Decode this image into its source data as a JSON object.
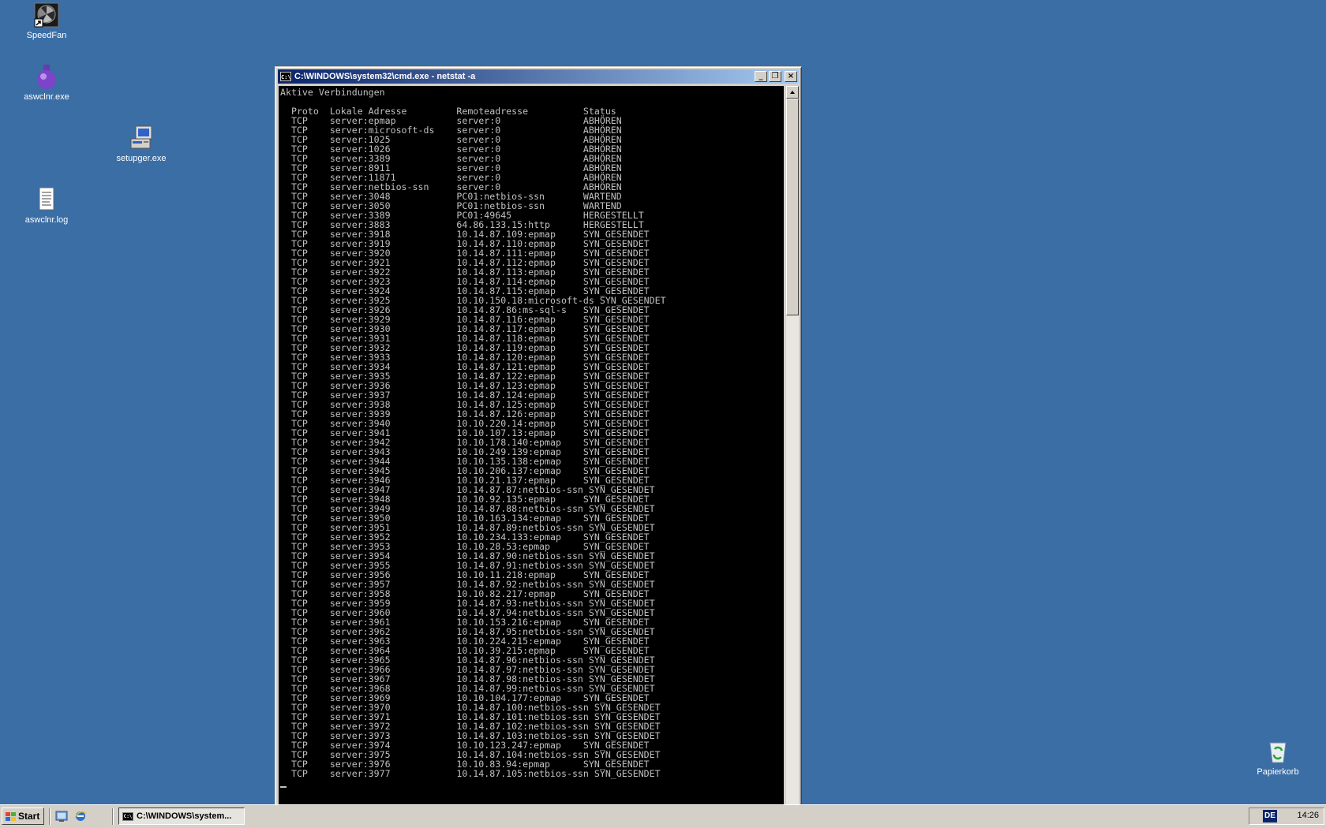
{
  "desktop": {
    "icons": [
      {
        "label": "SpeedFan",
        "icon": "speedfan-icon"
      },
      {
        "label": "aswclnr.exe",
        "icon": "purple-flask-icon"
      },
      {
        "label": "setupger.exe",
        "icon": "installer-computer-icon"
      },
      {
        "label": "aswclnr.log",
        "icon": "text-document-icon"
      },
      {
        "label": "Papierkorb",
        "icon": "recycle-bin-icon"
      }
    ]
  },
  "window": {
    "title": "C:\\WINDOWS\\system32\\cmd.exe - netstat -a",
    "icon_text": "C:\\",
    "buttons": {
      "minimize": "_",
      "restore": "❐",
      "close": "×"
    }
  },
  "console": {
    "heading": "Aktive Verbindungen",
    "columns": [
      "Proto",
      "Lokale Adresse",
      "Remoteadresse",
      "Status"
    ],
    "rows": [
      [
        "TCP",
        "server:epmap",
        "server:0",
        "ABHÖREN"
      ],
      [
        "TCP",
        "server:microsoft-ds",
        "server:0",
        "ABHÖREN"
      ],
      [
        "TCP",
        "server:1025",
        "server:0",
        "ABHÖREN"
      ],
      [
        "TCP",
        "server:1026",
        "server:0",
        "ABHÖREN"
      ],
      [
        "TCP",
        "server:3389",
        "server:0",
        "ABHÖREN"
      ],
      [
        "TCP",
        "server:8911",
        "server:0",
        "ABHÖREN"
      ],
      [
        "TCP",
        "server:11871",
        "server:0",
        "ABHÖREN"
      ],
      [
        "TCP",
        "server:netbios-ssn",
        "server:0",
        "ABHÖREN"
      ],
      [
        "TCP",
        "server:3048",
        "PC01:netbios-ssn",
        "WARTEND"
      ],
      [
        "TCP",
        "server:3050",
        "PC01:netbios-ssn",
        "WARTEND"
      ],
      [
        "TCP",
        "server:3389",
        "PC01:49645",
        "HERGESTELLT"
      ],
      [
        "TCP",
        "server:3883",
        "64.86.133.15:http",
        "HERGESTELLT"
      ],
      [
        "TCP",
        "server:3918",
        "10.14.87.109:epmap",
        "SYN_GESENDET"
      ],
      [
        "TCP",
        "server:3919",
        "10.14.87.110:epmap",
        "SYN_GESENDET"
      ],
      [
        "TCP",
        "server:3920",
        "10.14.87.111:epmap",
        "SYN_GESENDET"
      ],
      [
        "TCP",
        "server:3921",
        "10.14.87.112:epmap",
        "SYN_GESENDET"
      ],
      [
        "TCP",
        "server:3922",
        "10.14.87.113:epmap",
        "SYN_GESENDET"
      ],
      [
        "TCP",
        "server:3923",
        "10.14.87.114:epmap",
        "SYN_GESENDET"
      ],
      [
        "TCP",
        "server:3924",
        "10.14.87.115:epmap",
        "SYN_GESENDET"
      ],
      [
        "TCP",
        "server:3925",
        "10.10.150.18:microsoft-ds",
        "SYN_GESENDET"
      ],
      [
        "TCP",
        "server:3926",
        "10.14.87.86:ms-sql-s",
        "SYN_GESENDET"
      ],
      [
        "TCP",
        "server:3929",
        "10.14.87.116:epmap",
        "SYN_GESENDET"
      ],
      [
        "TCP",
        "server:3930",
        "10.14.87.117:epmap",
        "SYN_GESENDET"
      ],
      [
        "TCP",
        "server:3931",
        "10.14.87.118:epmap",
        "SYN_GESENDET"
      ],
      [
        "TCP",
        "server:3932",
        "10.14.87.119:epmap",
        "SYN_GESENDET"
      ],
      [
        "TCP",
        "server:3933",
        "10.14.87.120:epmap",
        "SYN_GESENDET"
      ],
      [
        "TCP",
        "server:3934",
        "10.14.87.121:epmap",
        "SYN_GESENDET"
      ],
      [
        "TCP",
        "server:3935",
        "10.14.87.122:epmap",
        "SYN_GESENDET"
      ],
      [
        "TCP",
        "server:3936",
        "10.14.87.123:epmap",
        "SYN_GESENDET"
      ],
      [
        "TCP",
        "server:3937",
        "10.14.87.124:epmap",
        "SYN_GESENDET"
      ],
      [
        "TCP",
        "server:3938",
        "10.14.87.125:epmap",
        "SYN_GESENDET"
      ],
      [
        "TCP",
        "server:3939",
        "10.14.87.126:epmap",
        "SYN_GESENDET"
      ],
      [
        "TCP",
        "server:3940",
        "10.10.220.14:epmap",
        "SYN_GESENDET"
      ],
      [
        "TCP",
        "server:3941",
        "10.10.107.13:epmap",
        "SYN_GESENDET"
      ],
      [
        "TCP",
        "server:3942",
        "10.10.178.140:epmap",
        "SYN_GESENDET"
      ],
      [
        "TCP",
        "server:3943",
        "10.10.249.139:epmap",
        "SYN_GESENDET"
      ],
      [
        "TCP",
        "server:3944",
        "10.10.135.138:epmap",
        "SYN_GESENDET"
      ],
      [
        "TCP",
        "server:3945",
        "10.10.206.137:epmap",
        "SYN_GESENDET"
      ],
      [
        "TCP",
        "server:3946",
        "10.10.21.137:epmap",
        "SYN_GESENDET"
      ],
      [
        "TCP",
        "server:3947",
        "10.14.87.87:netbios-ssn",
        "SYN_GESENDET"
      ],
      [
        "TCP",
        "server:3948",
        "10.10.92.135:epmap",
        "SYN_GESENDET"
      ],
      [
        "TCP",
        "server:3949",
        "10.14.87.88:netbios-ssn",
        "SYN_GESENDET"
      ],
      [
        "TCP",
        "server:3950",
        "10.10.163.134:epmap",
        "SYN_GESENDET"
      ],
      [
        "TCP",
        "server:3951",
        "10.14.87.89:netbios-ssn",
        "SYN_GESENDET"
      ],
      [
        "TCP",
        "server:3952",
        "10.10.234.133:epmap",
        "SYN_GESENDET"
      ],
      [
        "TCP",
        "server:3953",
        "10.10.28.53:epmap",
        "SYN_GESENDET"
      ],
      [
        "TCP",
        "server:3954",
        "10.14.87.90:netbios-ssn",
        "SYN_GESENDET"
      ],
      [
        "TCP",
        "server:3955",
        "10.14.87.91:netbios-ssn",
        "SYN_GESENDET"
      ],
      [
        "TCP",
        "server:3956",
        "10.10.11.218:epmap",
        "SYN_GESENDET"
      ],
      [
        "TCP",
        "server:3957",
        "10.14.87.92:netbios-ssn",
        "SYN_GESENDET"
      ],
      [
        "TCP",
        "server:3958",
        "10.10.82.217:epmap",
        "SYN_GESENDET"
      ],
      [
        "TCP",
        "server:3959",
        "10.14.87.93:netbios-ssn",
        "SYN_GESENDET"
      ],
      [
        "TCP",
        "server:3960",
        "10.14.87.94:netbios-ssn",
        "SYN_GESENDET"
      ],
      [
        "TCP",
        "server:3961",
        "10.10.153.216:epmap",
        "SYN_GESENDET"
      ],
      [
        "TCP",
        "server:3962",
        "10.14.87.95:netbios-ssn",
        "SYN_GESENDET"
      ],
      [
        "TCP",
        "server:3963",
        "10.10.224.215:epmap",
        "SYN_GESENDET"
      ],
      [
        "TCP",
        "server:3964",
        "10.10.39.215:epmap",
        "SYN_GESENDET"
      ],
      [
        "TCP",
        "server:3965",
        "10.14.87.96:netbios-ssn",
        "SYN_GESENDET"
      ],
      [
        "TCP",
        "server:3966",
        "10.14.87.97:netbios-ssn",
        "SYN_GESENDET"
      ],
      [
        "TCP",
        "server:3967",
        "10.14.87.98:netbios-ssn",
        "SYN_GESENDET"
      ],
      [
        "TCP",
        "server:3968",
        "10.14.87.99:netbios-ssn",
        "SYN_GESENDET"
      ],
      [
        "TCP",
        "server:3969",
        "10.10.104.177:epmap",
        "SYN_GESENDET"
      ],
      [
        "TCP",
        "server:3970",
        "10.14.87.100:netbios-ssn",
        "SYN_GESENDET"
      ],
      [
        "TCP",
        "server:3971",
        "10.14.87.101:netbios-ssn",
        "SYN_GESENDET"
      ],
      [
        "TCP",
        "server:3972",
        "10.14.87.102:netbios-ssn",
        "SYN_GESENDET"
      ],
      [
        "TCP",
        "server:3973",
        "10.14.87.103:netbios-ssn",
        "SYN_GESENDET"
      ],
      [
        "TCP",
        "server:3974",
        "10.10.123.247:epmap",
        "SYN_GESENDET"
      ],
      [
        "TCP",
        "server:3975",
        "10.14.87.104:netbios-ssn",
        "SYN_GESENDET"
      ],
      [
        "TCP",
        "server:3976",
        "10.10.83.94:epmap",
        "SYN_GESENDET"
      ],
      [
        "TCP",
        "server:3977",
        "10.14.87.105:netbios-ssn",
        "SYN_GESENDET"
      ]
    ]
  },
  "taskbar": {
    "start_label": "Start",
    "quick_launch": [
      {
        "icon": "show-desktop-icon"
      },
      {
        "icon": "internet-explorer-icon"
      }
    ],
    "task_label": "C:\\WINDOWS\\system...",
    "language": "DE",
    "clock": "14:26"
  },
  "colors": {
    "desktop": "#3a6ea5",
    "titlebar_start": "#0a246a",
    "titlebar_end": "#a6caf0",
    "console_bg": "#000000",
    "console_fg": "#c0c0c0"
  }
}
